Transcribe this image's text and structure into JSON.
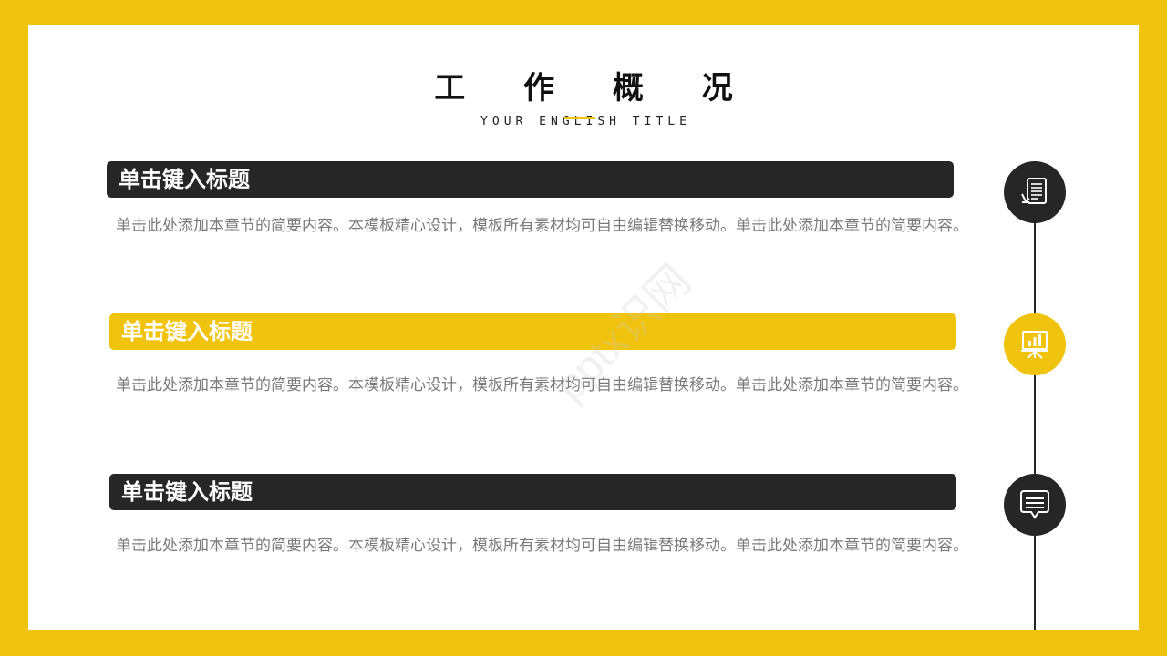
{
  "header": {
    "title": "工 作 概 况",
    "subtitle": "YOUR ENGLISH TITLE"
  },
  "sections": [
    {
      "heading": "单击键入标题",
      "body": "单击此处添加本章节的简要内容。本模板精心设计，模板所有素材均可自由编辑替换移动。单击此处添加本章节的简要内容。",
      "icon": "document-icon",
      "color": "#262626"
    },
    {
      "heading": "单击键入标题",
      "body": "单击此处添加本章节的简要内容。本模板精心设计，模板所有素材均可自由编辑替换移动。单击此处添加本章节的简要内容。",
      "icon": "presentation-chart-icon",
      "color": "#f0c30e"
    },
    {
      "heading": "单击键入标题",
      "body": "单击此处添加本章节的简要内容。本模板精心设计，模板所有素材均可自由编辑替换移动。单击此处添加本章节的简要内容。",
      "icon": "chat-bubble-icon",
      "color": "#262626"
    }
  ],
  "watermark": "pptx识网",
  "colors": {
    "accent": "#f0c30e",
    "dark": "#262626",
    "body_text": "#7a7a7a"
  }
}
